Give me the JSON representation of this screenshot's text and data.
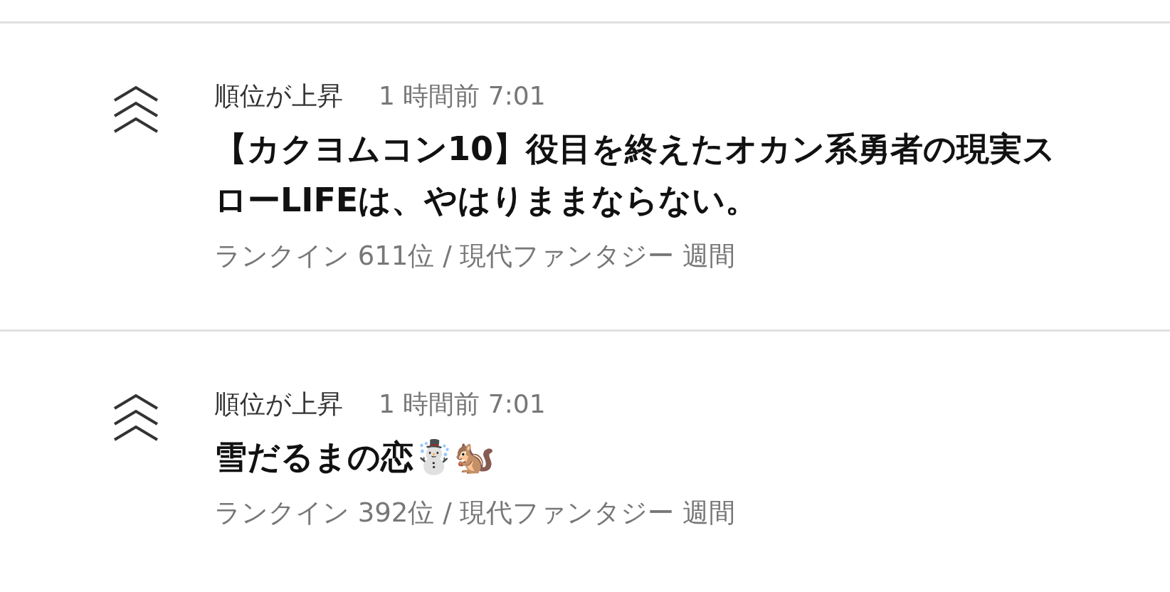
{
  "notifications": [
    {
      "kind": "rank_up",
      "heading": "順位が上昇",
      "time": "1 時間前 7:01",
      "title": "【カクヨムコン10】役目を終えたオカン系勇者の現実スローLIFEは、やはりままならない。",
      "detail": "ランクイン 611位 / 現代ファンタジー 週間"
    },
    {
      "kind": "rank_up",
      "heading": "順位が上昇",
      "time": "1 時間前 7:01",
      "title": "雪だるまの恋☃️🐿️",
      "detail": "ランクイン 392位 / 現代ファンタジー 週間"
    }
  ]
}
